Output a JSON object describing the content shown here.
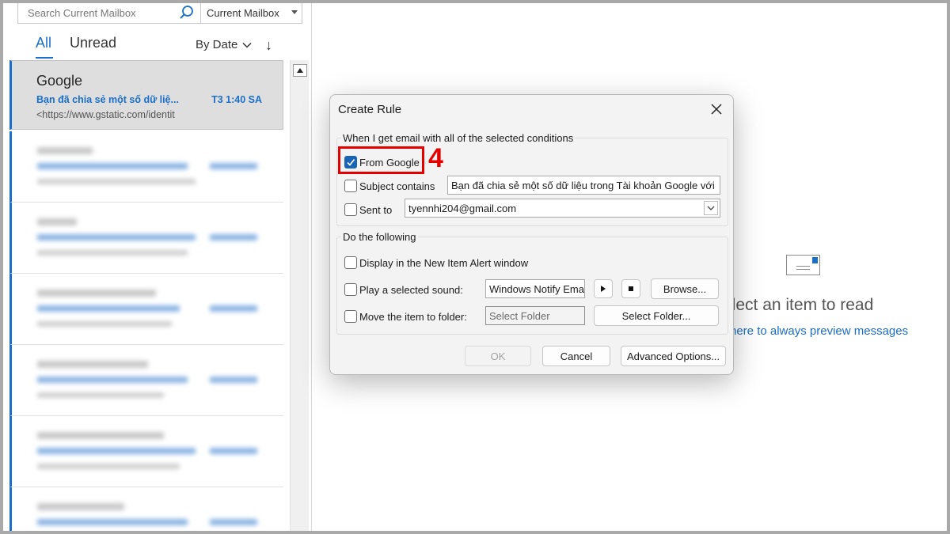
{
  "search": {
    "placeholder": "Search Current Mailbox",
    "scope": "Current Mailbox"
  },
  "filters": {
    "all": "All",
    "unread": "Unread",
    "sort": "By Date"
  },
  "selected_mail": {
    "sender": "Google",
    "subject": "Bạn đã chia sẻ một số dữ liệ...",
    "time": "T3 1:40 SA",
    "preview": "<https://www.gstatic.com/identit"
  },
  "reading_pane": {
    "title": "elect an item to read",
    "link": "here to always preview messages"
  },
  "dialog": {
    "title": "Create Rule",
    "conditions_label": "When I get email with all of the selected conditions",
    "from_label": "From Google",
    "subject_label": "Subject contains",
    "subject_value": "Bạn đã chia sẻ một số dữ liệu trong Tài khoản Google với",
    "sent_to_label": "Sent to",
    "sent_to_value": "tyennhi204@gmail.com",
    "actions_label": "Do the following",
    "alert_label": "Display in the New Item Alert window",
    "sound_label": "Play a selected sound:",
    "sound_value": "Windows Notify Ema",
    "browse_label": "Browse...",
    "move_label": "Move the item to folder:",
    "folder_placeholder": "Select Folder",
    "select_folder_label": "Select Folder...",
    "ok_label": "OK",
    "cancel_label": "Cancel",
    "advanced_label": "Advanced Options..."
  },
  "annotation": {
    "step": "4"
  },
  "colors": {
    "accent": "#1a6fc9",
    "highlight": "#e50000",
    "checkbox": "#1a64b8"
  }
}
